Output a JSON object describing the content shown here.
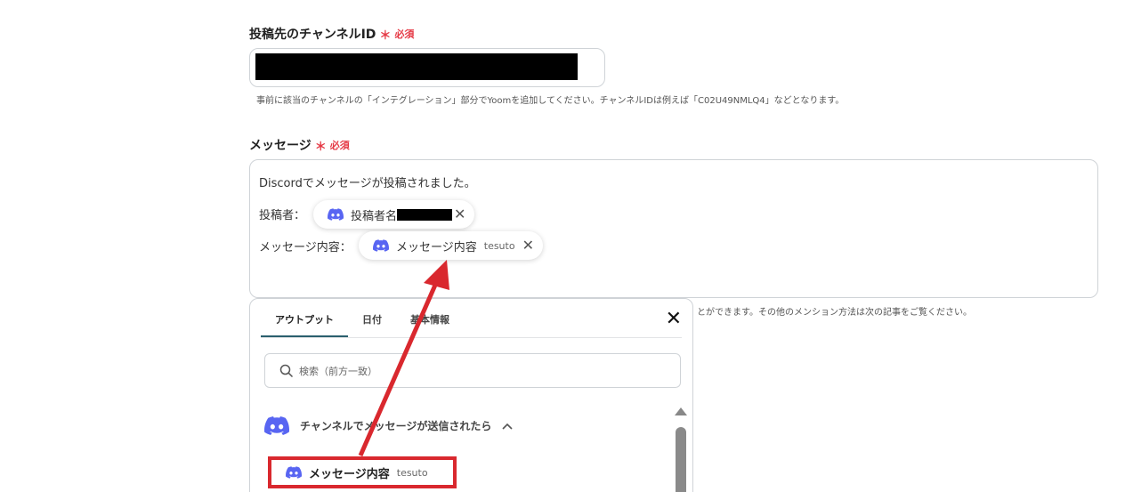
{
  "channel_field": {
    "label": "投稿先のチャンネルID",
    "required": "必須",
    "hint": "事前に該当のチャンネルの「インテグレーション」部分でYoomを追加してください。チャンネルIDは例えば「C02U49NMLQ4」などとなります。"
  },
  "message_field": {
    "label": "メッセージ",
    "required": "必須",
    "line1": "Discordでメッセージが投稿されました。",
    "poster_label": "投稿者：",
    "poster_pill": "投稿者名",
    "content_label": "メッセージ内容：",
    "content_pill": "メッセージ内容",
    "content_pill_sub": "tesuto",
    "hint_tail": "とができます。その他のメンション方法は次の記事をご覧ください。"
  },
  "panel": {
    "tabs": [
      "アウトプット",
      "日付",
      "基本情報"
    ],
    "close": "✕",
    "search_placeholder": "検索（前方一致）",
    "group_title": "チャンネルでメッセージが送信されたら",
    "item_label": "メッセージ内容",
    "item_sub": "tesuto"
  },
  "colors": {
    "required": "#e53945",
    "discord": "#5865f2",
    "annotation": "#d9282e",
    "tab_active": "#2a5f6e"
  }
}
